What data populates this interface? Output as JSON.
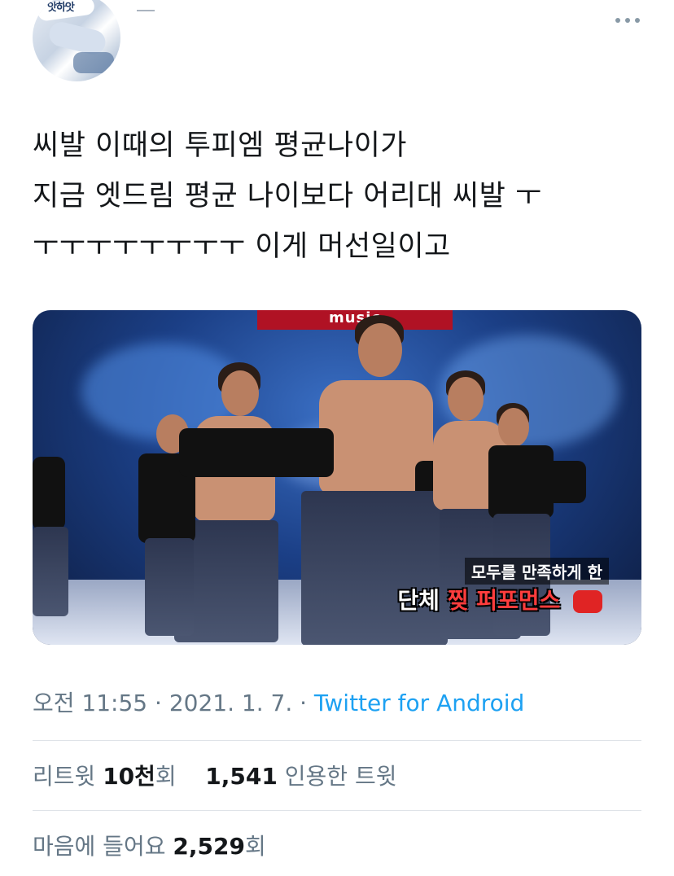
{
  "tweet": {
    "author_avatar_label": "앗하앗",
    "lines": [
      "씨발 이때의 투피엠 평균나이가",
      "지금 엣드림 평균 나이보다 어리대 씨발 ㅜ",
      "ㅜㅜㅜㅜㅜㅜㅜㅜ 이게 머선일이고"
    ],
    "more_icon": "more-horizontal-icon"
  },
  "media": {
    "banner_text": "music",
    "caption_top": "모두를 만족하게 한",
    "caption_bottom_prefix": "단체",
    "caption_bottom_highlight": "찢",
    "caption_bottom_suffix": "퍼포먼스"
  },
  "meta": {
    "time": "오전 11:55",
    "separator1": " · ",
    "date": "2021. 1. 7.",
    "separator2": " · ",
    "source": "Twitter for Android"
  },
  "stats": {
    "retweets_label": "리트윗",
    "retweets_value": "10천",
    "retweets_suffix": "회",
    "quotes_value": "1,541",
    "quotes_label": "인용한 트윗",
    "likes_label": "마음에 들어요",
    "likes_value": "2,529",
    "likes_suffix": "회"
  },
  "colors": {
    "link": "#1da1f2",
    "secondary_text": "#657786",
    "primary_text": "#14171a"
  }
}
